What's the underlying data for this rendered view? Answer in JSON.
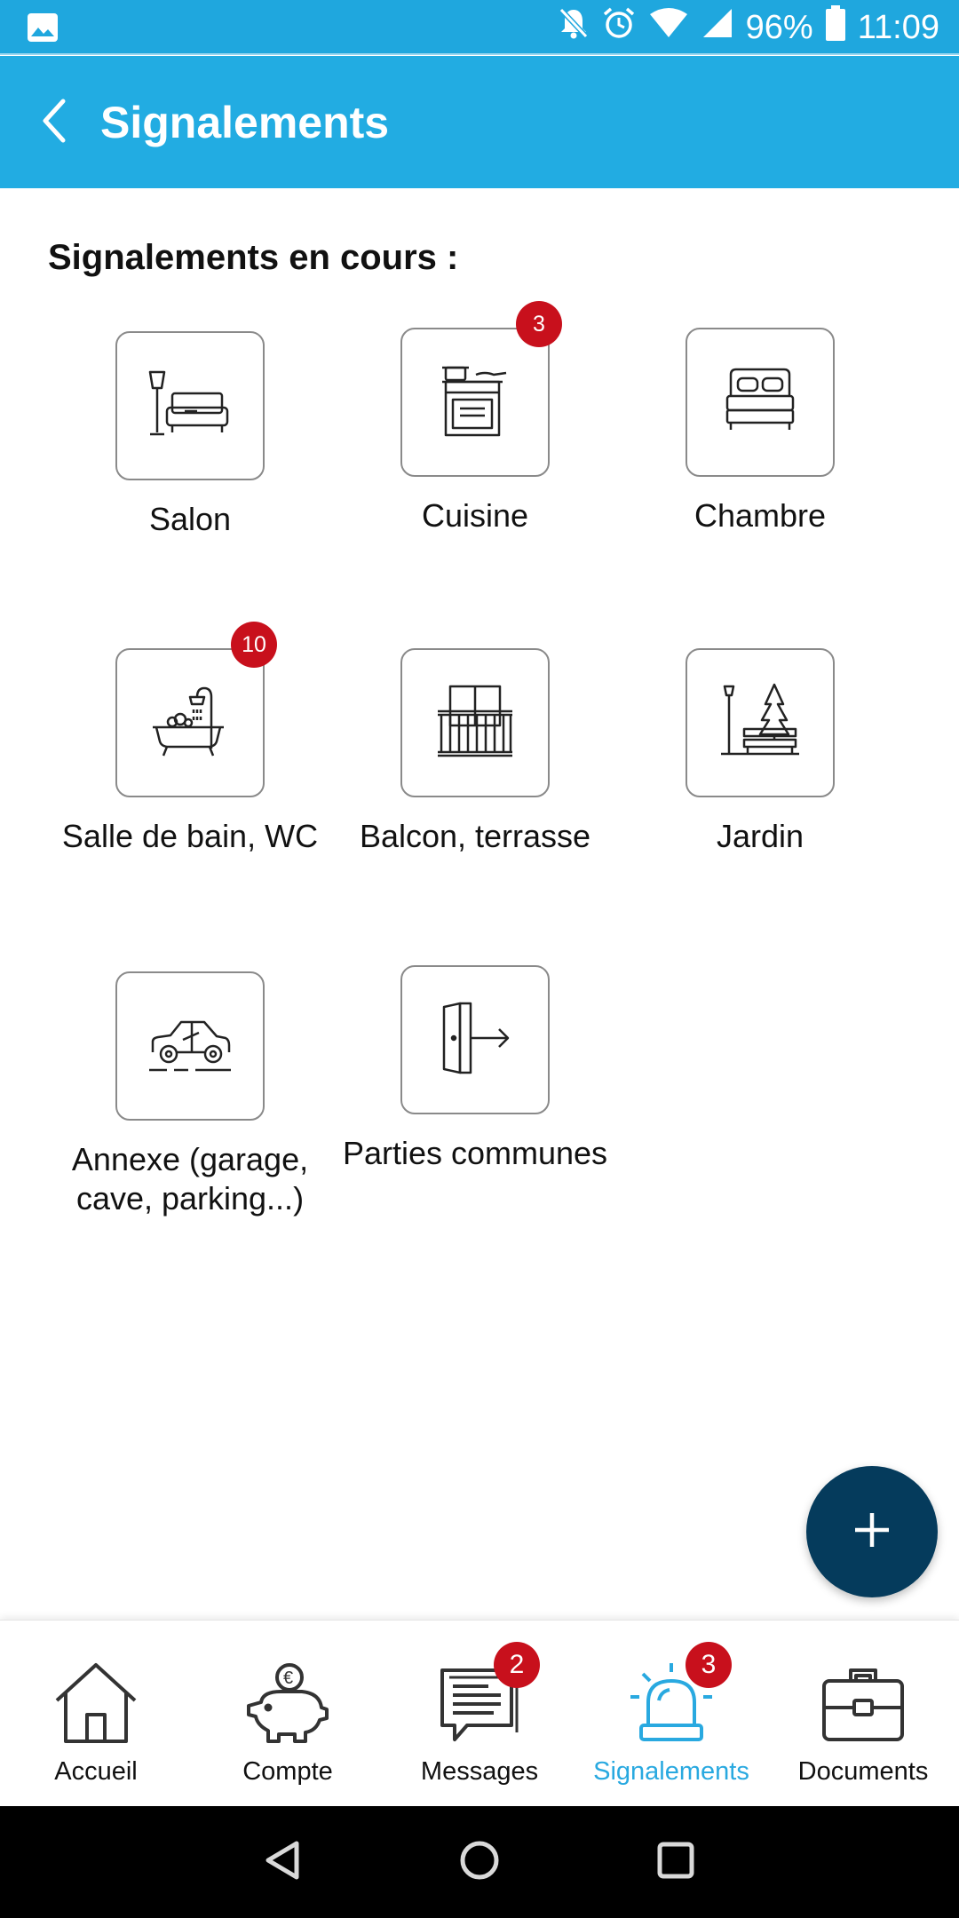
{
  "status_bar": {
    "battery": "96%",
    "time": "11:09",
    "icons": [
      "image-icon",
      "bell-off-icon",
      "alarm-icon",
      "wifi-icon",
      "signal-icon",
      "battery-icon"
    ]
  },
  "header": {
    "title": "Signalements",
    "back_icon": "chevron-left-icon"
  },
  "section_title": "Signalements en cours :",
  "categories": [
    {
      "label": "Salon",
      "icon": "living-room-icon",
      "badge": ""
    },
    {
      "label": "Cuisine",
      "icon": "kitchen-icon",
      "badge": "3"
    },
    {
      "label": "Chambre",
      "icon": "bed-icon",
      "badge": ""
    },
    {
      "label": "Salle de bain, WC",
      "icon": "bathtub-icon",
      "badge": "10"
    },
    {
      "label": "Balcon, terrasse",
      "icon": "balcony-icon",
      "badge": ""
    },
    {
      "label": "Jardin",
      "icon": "garden-icon",
      "badge": ""
    },
    {
      "label": "Annexe (garage, cave, parking...)",
      "icon": "car-icon",
      "badge": ""
    },
    {
      "label": "Parties communes",
      "icon": "door-exit-icon",
      "badge": ""
    }
  ],
  "fab": {
    "icon": "plus-icon"
  },
  "bottom_nav": [
    {
      "label": "Accueil",
      "icon": "home-icon",
      "badge": "",
      "active": false
    },
    {
      "label": "Compte",
      "icon": "piggy-bank-icon",
      "badge": "",
      "active": false
    },
    {
      "label": "Messages",
      "icon": "message-icon",
      "badge": "2",
      "active": false
    },
    {
      "label": "Signalements",
      "icon": "siren-icon",
      "badge": "3",
      "active": true
    },
    {
      "label": "Documents",
      "icon": "briefcase-icon",
      "badge": "",
      "active": false
    }
  ],
  "colors": {
    "status_bar": "#1fa7de",
    "app_bar": "#22ace2",
    "badge": "#c8101c",
    "fab": "#053b5c",
    "nav_active": "#29a9e0"
  }
}
